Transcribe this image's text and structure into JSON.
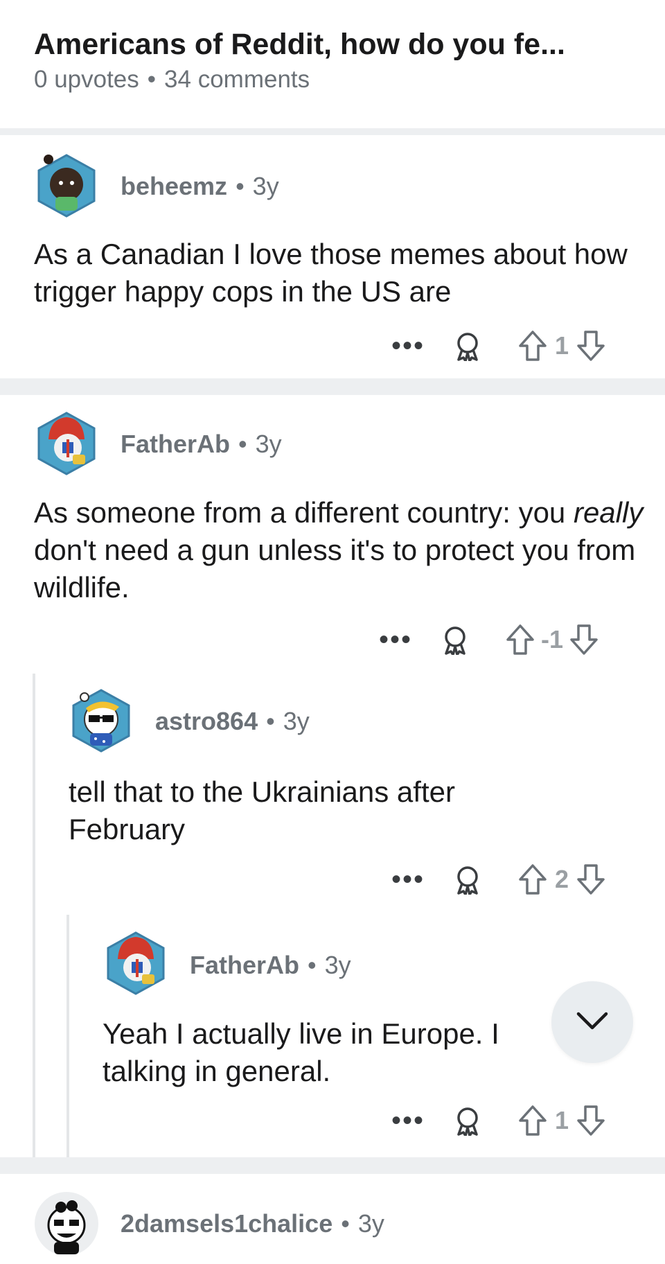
{
  "post": {
    "title": "Americans of Reddit, how do you fe...",
    "upvotes": "0 upvotes",
    "separator": "•",
    "comments": "34 comments"
  },
  "comments": [
    {
      "author": "beheemz",
      "age": "3y",
      "body": "As a Canadian I love those memes about how trigger happy cops in the US are",
      "score": "1",
      "more": "•••"
    },
    {
      "author": "FatherAb",
      "age": "3y",
      "body_before": "As someone from a different country: you ",
      "body_em": "really",
      "body_after": " don't need a gun unless it's to protect you from wildlife.",
      "score": "-1",
      "more": "•••"
    },
    {
      "author": "astro864",
      "age": "3y",
      "body": "tell that to the Ukrainians after February",
      "score": "2",
      "more": "•••"
    },
    {
      "author": "FatherAb",
      "age": "3y",
      "body": "Yeah I actually live in Europe. I",
      "body_line2": "talking in general.",
      "score": "1",
      "more": "•••"
    },
    {
      "author": "2damsels1chalice",
      "age": "3y"
    }
  ],
  "dot": "•",
  "icons": {
    "award": "award-icon",
    "upvote": "upvote-arrow-icon",
    "downvote": "downvote-arrow-icon",
    "scroll": "chevron-down-icon"
  },
  "colors": {
    "text": "#1a1a1b",
    "meta": "#6b7177",
    "divider": "#edeff1"
  }
}
